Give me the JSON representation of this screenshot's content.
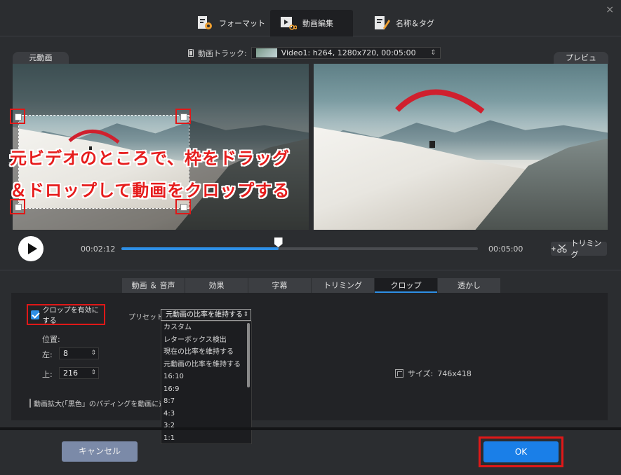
{
  "tabs": [
    {
      "label": "フォーマット",
      "icon": "format-settings-icon"
    },
    {
      "label": "動画編集",
      "icon": "video-edit-icon",
      "active": true
    },
    {
      "label": "名称＆タグ",
      "icon": "name-tag-icon"
    }
  ],
  "close_icon": "×",
  "panels": {
    "original_label": "元動画",
    "preview_label": "プレビュー"
  },
  "track": {
    "label": "動画トラック:",
    "value": "Video1: h264, 1280x720, 00:05:00"
  },
  "callout": {
    "line1": "元ビデオのところで、枠をドラッグ",
    "line2": "＆ドロップして動画をクロップする"
  },
  "playback": {
    "current": "00:02:12",
    "duration": "00:05:00",
    "progress": 0.44,
    "trim_label": "トリミング"
  },
  "subtabs": [
    {
      "label": "動画 ＆ 音声"
    },
    {
      "label": "効果"
    },
    {
      "label": "字幕"
    },
    {
      "label": "トリミング"
    },
    {
      "label": "クロップ",
      "active": true
    },
    {
      "label": "透かし"
    }
  ],
  "crop": {
    "enable_label": "クロップを有効にする",
    "enabled": true,
    "preset_label": "プリセット:",
    "preset_value": "元動画の比率を維持する",
    "preset_options": [
      "カスタム",
      "レターボックス検出",
      "現在の比率を維持する",
      "元動画の比率を維持する",
      "16:10",
      "16:9",
      "8:7",
      "4:3",
      "3:2",
      "1:1"
    ],
    "position_title": "位置:",
    "left_label": "左:",
    "left_value": "8",
    "top_label": "上:",
    "top_value": "216",
    "size_label": "サイズ:",
    "size_value": "746x418",
    "padding_label": "動画拡大(「黒色」のパディングを動画に追"
  },
  "footer": {
    "cancel_label": "キャンセル",
    "ok_label": "OK"
  },
  "colors": {
    "accent": "#2e8fe6",
    "highlight": "#e01818",
    "ok": "#1a7fe8"
  }
}
